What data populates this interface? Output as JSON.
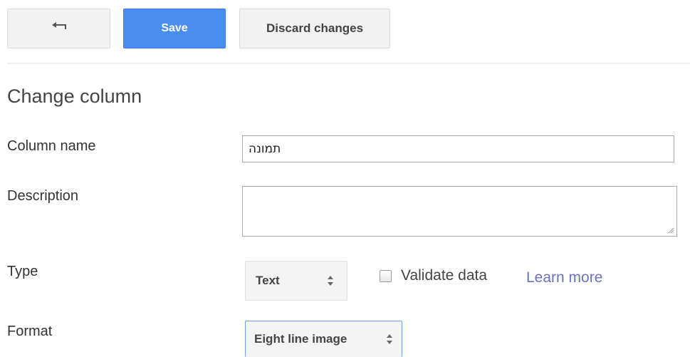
{
  "toolbar": {
    "back_icon": "back-arrow-icon",
    "save_label": "Save",
    "discard_label": "Discard changes"
  },
  "form": {
    "heading": "Change column",
    "column_name": {
      "label": "Column name",
      "value": "תמונה"
    },
    "description": {
      "label": "Description",
      "value": ""
    },
    "type": {
      "label": "Type",
      "selected": "Text",
      "validate_label": "Validate data",
      "validate_checked": false,
      "learn_more": "Learn more"
    },
    "format": {
      "label": "Format",
      "selected": "Eight line image"
    }
  },
  "colors": {
    "primary": "#4a8ef0",
    "link": "#6a72c4",
    "focus_border": "#6fa1ea"
  }
}
